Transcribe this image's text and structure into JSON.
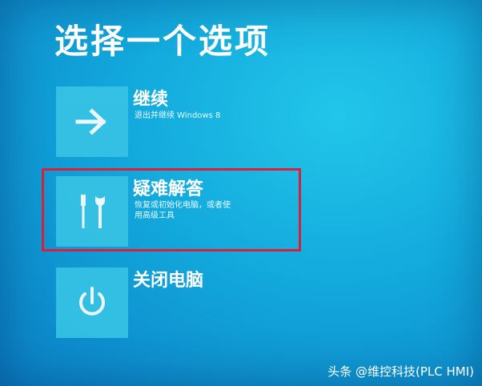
{
  "title": "选择一个选项",
  "options": [
    {
      "icon": "arrow-right-icon",
      "title": "继续",
      "desc": "退出并继续 Windows 8"
    },
    {
      "icon": "tools-icon",
      "title": "疑难解答",
      "desc": "恢复或初始化电脑，或者使用高级工具"
    },
    {
      "icon": "power-icon",
      "title": "关闭电脑",
      "desc": ""
    }
  ],
  "highlight_color": "#d8203a",
  "watermark": "头条 @维控科技(PLC HMI)"
}
